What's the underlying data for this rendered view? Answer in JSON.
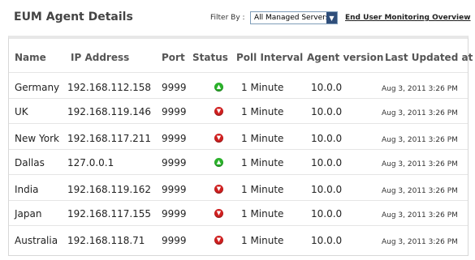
{
  "header": {
    "title": "EUM Agent Details",
    "filter_label": "Filter By :",
    "filter_value": "All Managed Servers",
    "overview_link": "End User Monitoring Overview"
  },
  "table": {
    "columns": [
      "Name",
      "IP Address",
      "Port",
      "Status",
      "Poll Interval",
      "Agent version",
      "Last Updated at"
    ],
    "rows": [
      {
        "name": "Germany",
        "ip": "192.168.112.158",
        "port": "9999",
        "status": "up",
        "poll": "1 Minute",
        "version": "10.0.0",
        "updated": "Aug 3, 2011 3:26 PM"
      },
      {
        "name": "UK",
        "ip": "192.168.119.146",
        "port": "9999",
        "status": "down",
        "poll": "1 Minute",
        "version": "10.0.0",
        "updated": "Aug 3, 2011 3:26 PM"
      },
      {
        "name": "New York",
        "ip": "192.168.117.211",
        "port": "9999",
        "status": "down",
        "poll": "1 Minute",
        "version": "10.0.0",
        "updated": "Aug 3, 2011 3:26 PM"
      },
      {
        "name": "Dallas",
        "ip": "127.0.0.1",
        "port": "9999",
        "status": "up",
        "poll": "1 Minute",
        "version": "10.0.0",
        "updated": "Aug 3, 2011 3:26 PM"
      },
      {
        "name": "India",
        "ip": "192.168.119.162",
        "port": "9999",
        "status": "down",
        "poll": "1 Minute",
        "version": "10.0.0",
        "updated": "Aug 3, 2011 3:26 PM"
      },
      {
        "name": "Japan",
        "ip": "192.168.117.155",
        "port": "9999",
        "status": "down",
        "poll": "1 Minute",
        "version": "10.0.0",
        "updated": "Aug 3, 2011 3:26 PM"
      },
      {
        "name": "Australia",
        "ip": "192.168.118.71",
        "port": "9999",
        "status": "down",
        "poll": "1 Minute",
        "version": "10.0.0",
        "updated": "Aug 3, 2011 3:26 PM"
      }
    ]
  },
  "status_icons": {
    "up": "arrow-up-icon",
    "down": "arrow-down-icon"
  },
  "colors": {
    "up": "#2bb22b",
    "down": "#d02020"
  }
}
